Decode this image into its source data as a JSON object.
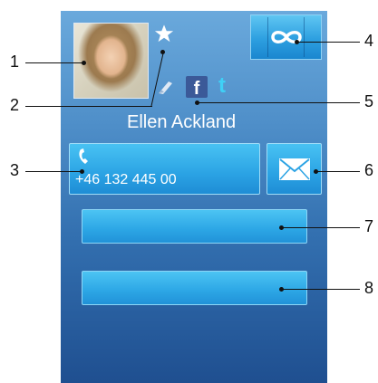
{
  "contact": {
    "name": "Ellen Ackland",
    "phone": "+46 132 445 00"
  },
  "callouts": {
    "c1": "1",
    "c2": "2",
    "c3": "3",
    "c4": "4",
    "c5": "5",
    "c6": "6",
    "c7": "7",
    "c8": "8"
  },
  "icons": {
    "favorite": "star-icon",
    "loop": "infinity-icon",
    "facebook": "facebook-icon",
    "twitter": "twitter-icon",
    "facebook_glyph": "f",
    "twitter_glyph": "t",
    "call": "phone-icon",
    "message": "envelope-icon",
    "service": "pen-icon"
  },
  "colors": {
    "screen_top": "#6aa9dc",
    "screen_bottom": "#1f4f90",
    "button": "#2ba3e4",
    "facebook": "#3b5998",
    "twitter": "#3fd0f6"
  }
}
